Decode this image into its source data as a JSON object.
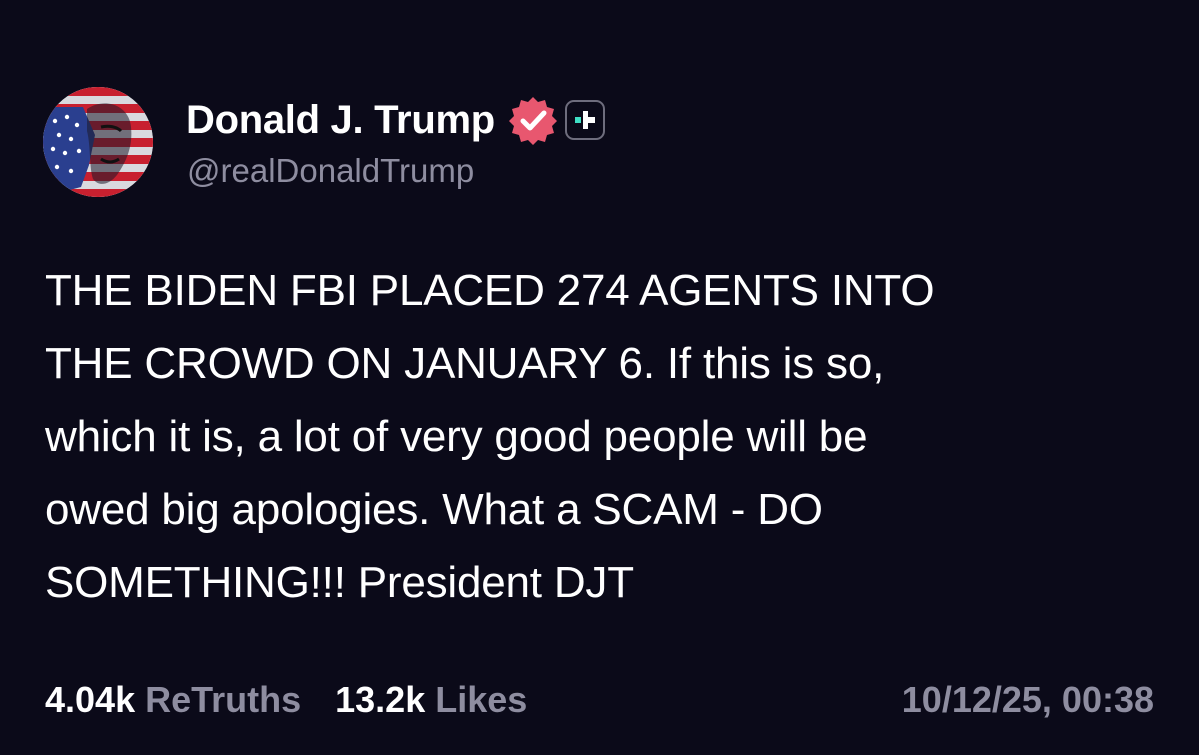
{
  "author": {
    "display_name": "Donald J. Trump",
    "handle": "@realDonaldTrump",
    "verified_icon": "verified-badge-icon",
    "plus_icon": "plus-badge-icon",
    "verified_color": "#e8576f"
  },
  "post": {
    "lines": [
      "THE BIDEN FBI PLACED 274 AGENTS INTO",
      "THE CROWD ON JANUARY 6. If this is so,",
      "which it is, a lot of very good people will be",
      "owed big apologies. What a SCAM - DO",
      "SOMETHING!!! President DJT"
    ]
  },
  "stats": {
    "retruths_value": "4.04k",
    "retruths_label": "ReTruths",
    "likes_value": "13.2k",
    "likes_label": "Likes"
  },
  "timestamp": "10/12/25, 00:38",
  "colors": {
    "background": "#0b0a19",
    "text": "#ffffff",
    "muted": "#8e8da0",
    "plus_accent": "#3fe0c5"
  }
}
